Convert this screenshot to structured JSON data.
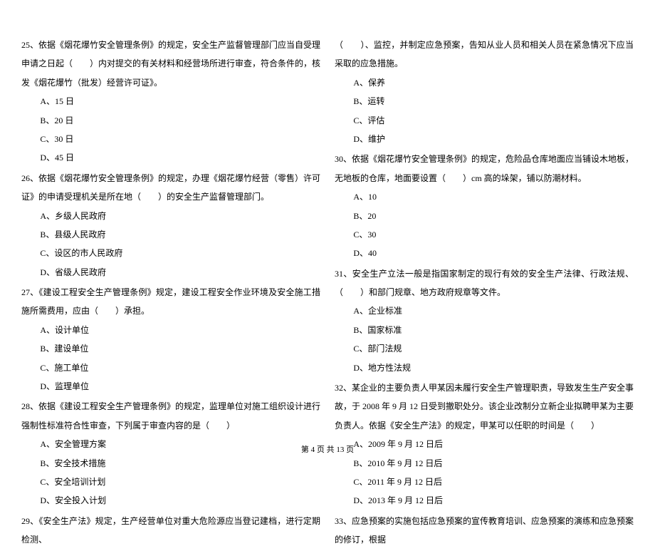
{
  "layout": {
    "columns": 2
  },
  "left": {
    "q25": {
      "text": "25、依据《烟花爆竹安全管理条例》的规定，安全生产监督管理部门应当自受理申请之日起（　　）内对提交的有关材料和经营场所进行审查，符合条件的，核发《烟花爆竹（批发）经营许可证》。",
      "opts": {
        "a": "A、15 日",
        "b": "B、20 日",
        "c": "C、30 日",
        "d": "D、45 日"
      }
    },
    "q26": {
      "text": "26、依据《烟花爆竹安全管理条例》的规定，办理《烟花爆竹经营（零售）许可证》的申请受理机关是所在地（　　）的安全生产监督管理部门。",
      "opts": {
        "a": "A、乡级人民政府",
        "b": "B、县级人民政府",
        "c": "C、设区的市人民政府",
        "d": "D、省级人民政府"
      }
    },
    "q27": {
      "text": "27、《建设工程安全生产管理条例》规定，建设工程安全作业环境及安全施工措施所需费用，应由（　　）承担。",
      "opts": {
        "a": "A、设计单位",
        "b": "B、建设单位",
        "c": "C、施工单位",
        "d": "D、监理单位"
      }
    },
    "q28": {
      "text": "28、依据《建设工程安全生产管理条例》的规定，监理单位对施工组织设计进行强制性标准符合性审查，下列属于审查内容的是（　　）",
      "opts": {
        "a": "A、安全管理方案",
        "b": "B、安全技术措施",
        "c": "C、安全培训计划",
        "d": "D、安全投入计划"
      }
    },
    "q29": {
      "text": "29、《安全生产法》规定，生产经营单位对重大危险源应当登记建档，进行定期检测、"
    }
  },
  "right": {
    "q29cont": {
      "text": "（　　）、监控，并制定应急预案，告知从业人员和相关人员在紧急情况下应当采取的应急措施。",
      "opts": {
        "a": "A、保养",
        "b": "B、运转",
        "c": "C、评估",
        "d": "D、维护"
      }
    },
    "q30": {
      "text": "30、依据《烟花爆竹安全管理条例》的规定，危险品仓库地面应当铺设木地板，无地板的仓库，地面要设置（　　）cm 高的垛架，铺以防潮材料。",
      "opts": {
        "a": "A、10",
        "b": "B、20",
        "c": "C、30",
        "d": "D、40"
      }
    },
    "q31": {
      "text": "31、安全生产立法一般是指国家制定的现行有效的安全生产法律、行政法规、（　　）和部门规章、地方政府规章等文件。",
      "opts": {
        "a": "A、企业标准",
        "b": "B、国家标准",
        "c": "C、部门法规",
        "d": "D、地方性法规"
      }
    },
    "q32": {
      "text": "32、某企业的主要负责人甲某因未履行安全生产管理职责，导致发生生产安全事故，于 2008 年 9 月 12 日受到撤职处分。该企业改制分立新企业拟聘甲某为主要负责人。依据《安全生产法》的规定，甲某可以任职的时间是（　　）",
      "opts": {
        "a": "A、2009 年 9 月 12 日后",
        "b": "B、2010 年 9 月 12 日后",
        "c": "C、2011 年 9 月 12 日后",
        "d": "D、2013 年 9 月 12 日后"
      }
    },
    "q33": {
      "text": "33、应急预案的实施包括应急预案的宣传教育培训、应急预案的演练和应急预案的修订，根据"
    }
  },
  "footer": "第 4 页 共 13 页"
}
